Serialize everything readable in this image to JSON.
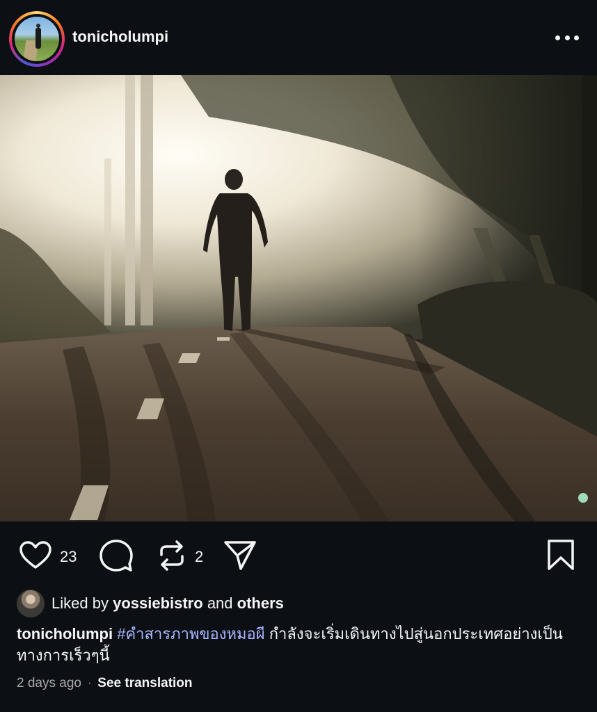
{
  "post": {
    "username": "tonicholumpi",
    "image_alt": "Silhouette of a person walking on a foggy road with sunlight through trees"
  },
  "actions": {
    "like_count": "23",
    "repost_count": "2",
    "icons": [
      "heart-icon",
      "comment-icon",
      "repost-icon",
      "share-icon",
      "bookmark-icon"
    ]
  },
  "likes": {
    "prefix": "Liked by",
    "user": "yossiebistro",
    "conjunction": "and",
    "others": "others"
  },
  "caption": {
    "username": "tonicholumpi",
    "hashtag": "#คำสารภาพของหมอผี",
    "text": "กำลังจะเริ่มเดินทางไปสู่นอกประเทศอย่างเป็นทางการเร็วๆนี้"
  },
  "meta": {
    "time": "2 days ago",
    "separator": "·",
    "see_translation": "See translation"
  },
  "colors": {
    "background": "#0c1014",
    "text": "#f5f5f5",
    "hashtag": "#a9b7ff",
    "muted": "#a8a8a8"
  }
}
